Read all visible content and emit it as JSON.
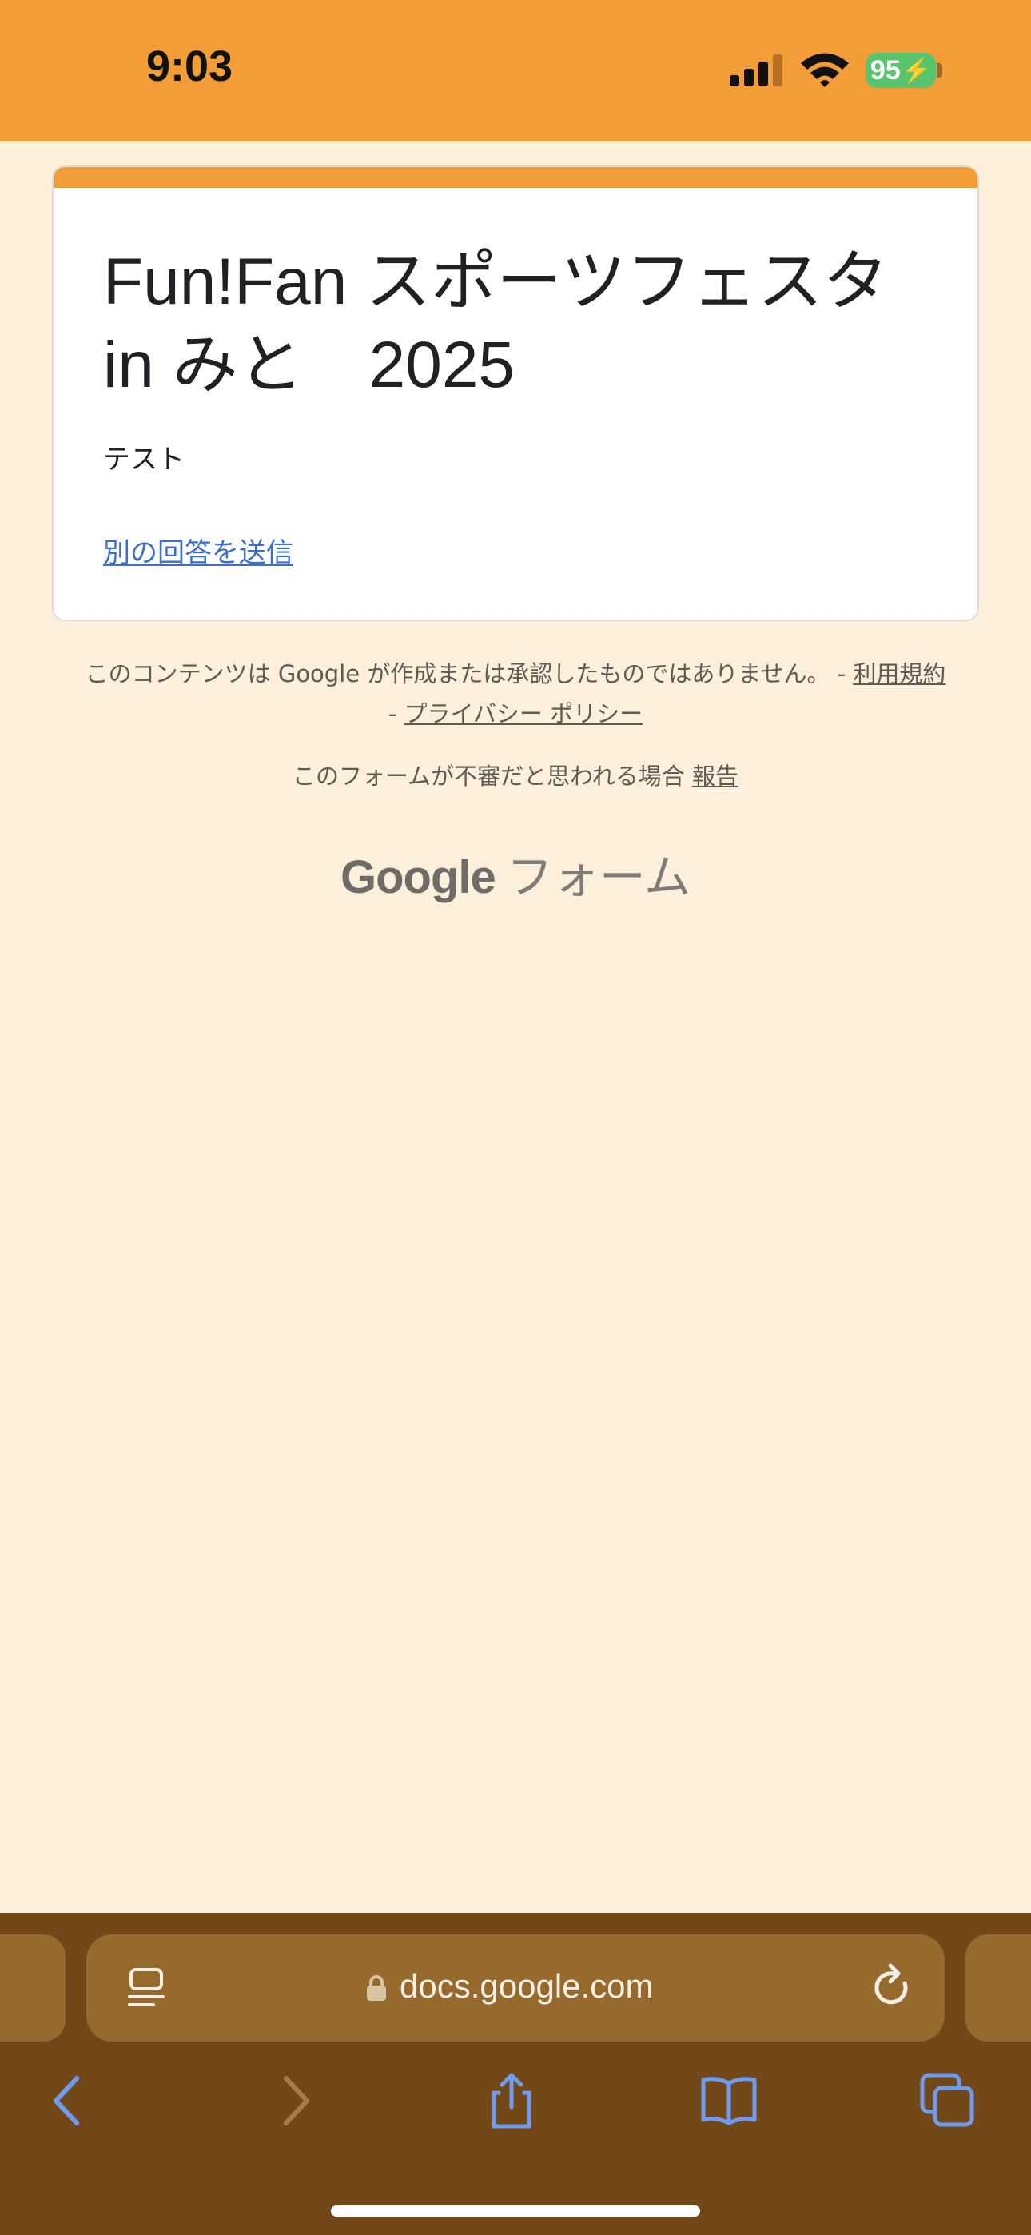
{
  "status_bar": {
    "time": "9:03",
    "battery": "95"
  },
  "form": {
    "title": "Fun!Fan スポーツフェスタ in みと　2025",
    "description": "テスト",
    "resubmit_link": "別の回答を送信"
  },
  "footer": {
    "disclaimer": "このコンテンツは Google が作成または承認したものではありません。 -",
    "terms_link": "利用規約",
    "separator": "-",
    "privacy_link": "プライバシー ポリシー",
    "report_text": "このフォームが不審だと思われる場合",
    "report_link": "報告",
    "brand_google": "Google",
    "brand_forms": "フォーム"
  },
  "browser": {
    "url": "docs.google.com"
  },
  "colors": {
    "theme": "#f29d38",
    "background": "#fcefdc",
    "toolbar": "#734818",
    "address_bar": "#966a2c",
    "link": "#3c6ecf",
    "nav_icon": "#6f9cf0"
  }
}
